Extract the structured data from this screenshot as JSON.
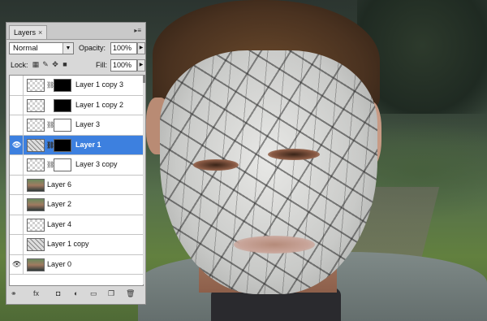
{
  "panel": {
    "tab_label": "Layers",
    "tab_close": "×",
    "menu_icon": "panel-menu-icon",
    "blend_mode": "Normal",
    "opacity_label": "Opacity:",
    "opacity_value": "100%",
    "lock_label": "Lock:",
    "fill_label": "Fill:",
    "fill_value": "100%"
  },
  "layers": [
    {
      "name": "Layer 1 copy 3",
      "visible": false,
      "thumb": "checker",
      "mask": "maskblack",
      "linked": true,
      "selected": false
    },
    {
      "name": "Layer 1 copy 2",
      "visible": false,
      "thumb": "checker",
      "mask": "maskblack",
      "linked": false,
      "selected": false
    },
    {
      "name": "Layer 3",
      "visible": false,
      "thumb": "checker",
      "mask": "maskwhite",
      "linked": true,
      "selected": false
    },
    {
      "name": "Layer 1",
      "visible": true,
      "thumb": "crack-thumb",
      "mask": "maskblack",
      "linked": true,
      "selected": true
    },
    {
      "name": "Layer 3 copy",
      "visible": false,
      "thumb": "checker",
      "mask": "maskwhite",
      "linked": true,
      "selected": false
    },
    {
      "name": "Layer 6",
      "visible": false,
      "thumb": "photo-thumb",
      "mask": "",
      "linked": false,
      "selected": false
    },
    {
      "name": "Layer 2",
      "visible": false,
      "thumb": "photo-thumb",
      "mask": "",
      "linked": false,
      "selected": false
    },
    {
      "name": "Layer 4",
      "visible": false,
      "thumb": "checker",
      "mask": "",
      "linked": false,
      "selected": false
    },
    {
      "name": "Layer 1 copy",
      "visible": false,
      "thumb": "crack-thumb",
      "mask": "",
      "linked": false,
      "selected": false
    },
    {
      "name": "Layer 0",
      "visible": true,
      "thumb": "photo-thumb",
      "mask": "",
      "linked": false,
      "selected": false
    }
  ],
  "bottom_icons": [
    "link-layers-icon",
    "fx-icon",
    "add-mask-icon",
    "adjustment-layer-icon",
    "new-group-icon",
    "new-layer-icon",
    "delete-layer-icon"
  ],
  "bottom_glyphs": [
    "⚭",
    "fx",
    "◘",
    "◐",
    "▭",
    "❐",
    "🗑"
  ]
}
